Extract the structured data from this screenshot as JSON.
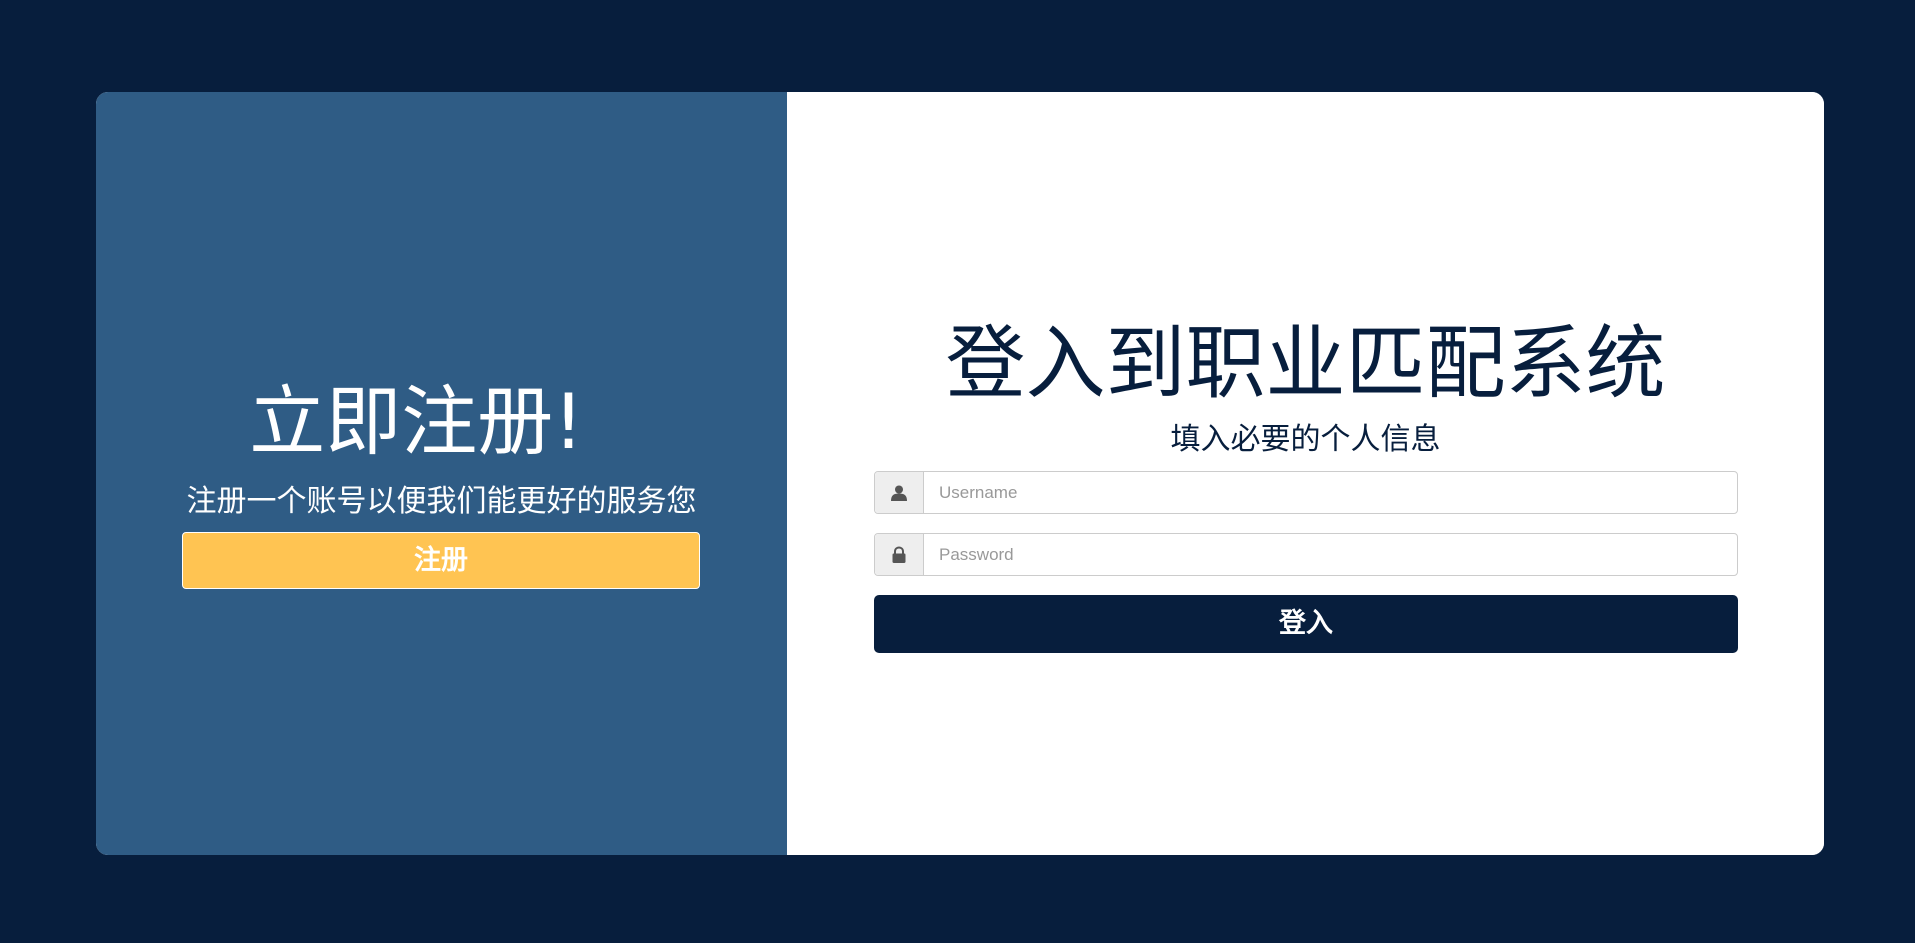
{
  "signup_panel": {
    "title": "立即注册!",
    "subtitle": "注册一个账号以便我们能更好的服务您",
    "button_label": "注册"
  },
  "login_panel": {
    "title": "登入到职业匹配系统",
    "subtitle": "填入必要的个人信息",
    "username": {
      "icon": "user-icon",
      "placeholder": "Username",
      "value": ""
    },
    "password": {
      "icon": "lock-icon",
      "placeholder": "Password",
      "value": ""
    },
    "button_label": "登入"
  },
  "colors": {
    "background": "#071e3d",
    "signup_panel": "#2f5c85",
    "signup_button": "#ffc452",
    "login_button": "#071e3d",
    "text_dark": "#071e3d",
    "text_light": "#ffffff"
  }
}
